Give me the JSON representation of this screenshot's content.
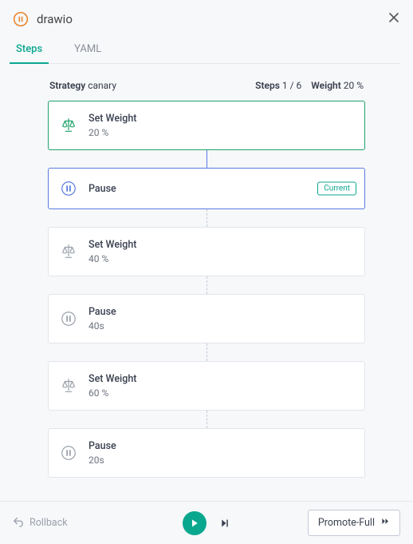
{
  "header": {
    "title": "drawio",
    "status_icon": "pause-circle",
    "tabs": [
      {
        "label": "Steps",
        "active": true
      },
      {
        "label": "YAML",
        "active": false
      }
    ]
  },
  "summary": {
    "strategy_label": "Strategy",
    "strategy_value": "canary",
    "steps_label": "Steps",
    "steps_value": "1 / 6",
    "weight_label": "Weight",
    "weight_value": "20 %"
  },
  "steps": [
    {
      "type": "weight",
      "title": "Set Weight",
      "sub": "20 %",
      "state": "done"
    },
    {
      "type": "pause",
      "title": "Pause",
      "sub": "",
      "state": "current",
      "badge": "Current"
    },
    {
      "type": "weight",
      "title": "Set Weight",
      "sub": "40 %",
      "state": "pending"
    },
    {
      "type": "pause",
      "title": "Pause",
      "sub": "40s",
      "state": "pending"
    },
    {
      "type": "weight",
      "title": "Set Weight",
      "sub": "60 %",
      "state": "pending"
    },
    {
      "type": "pause",
      "title": "Pause",
      "sub": "20s",
      "state": "pending"
    }
  ],
  "footer": {
    "rollback_label": "Rollback",
    "promote_label": "Promote-Full"
  },
  "colors": {
    "accent": "#0aa78f",
    "done_border": "#1fa36b",
    "current_border": "#5a7be0",
    "orange": "#e98c3a"
  }
}
